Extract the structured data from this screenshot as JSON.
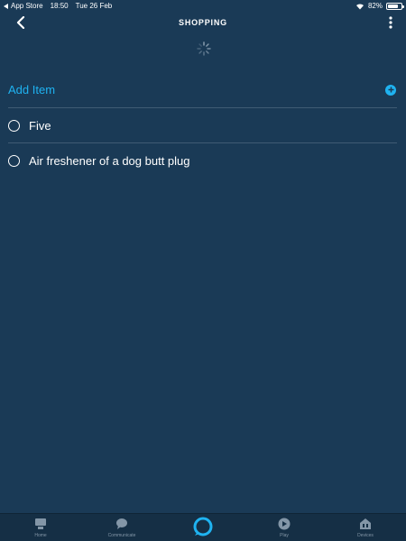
{
  "status_bar": {
    "back_app": "App Store",
    "time": "18:50",
    "date": "Tue 26 Feb",
    "battery": "82%",
    "battery_level": 0.82
  },
  "header": {
    "title": "SHOPPING"
  },
  "list": {
    "add_label": "Add Item",
    "items": [
      {
        "label": "Five"
      },
      {
        "label": "Air freshener of a dog butt plug"
      }
    ]
  },
  "bottom_nav": {
    "items": [
      {
        "label": "Home",
        "icon": "home-icon"
      },
      {
        "label": "Communicate",
        "icon": "chat-bubble-icon"
      },
      {
        "label": "",
        "icon": "alexa-ring-icon"
      },
      {
        "label": "Play",
        "icon": "play-icon"
      },
      {
        "label": "Devices",
        "icon": "devices-icon"
      }
    ]
  },
  "colors": {
    "background": "#1a3a56",
    "accent": "#1fb3f1",
    "divider": "#3f5b74",
    "nav_background": "#152f45",
    "nav_label": "#8396a7"
  }
}
